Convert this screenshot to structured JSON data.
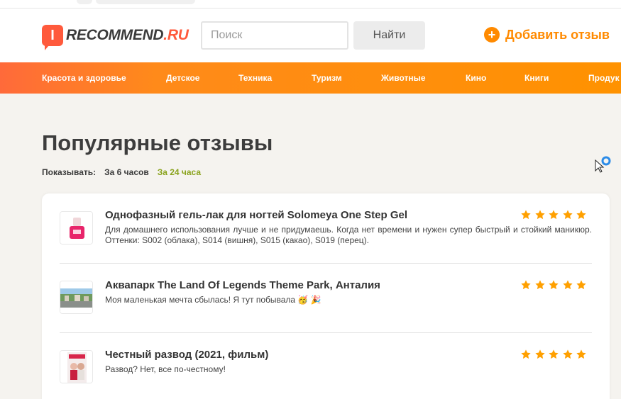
{
  "colors": {
    "brand_orange": "#ff8a00",
    "brand_red": "#ff5a3c",
    "active_filter": "#8aa31e",
    "star": "#ffa000"
  },
  "header": {
    "logo_mark": "I",
    "logo_main": "RECOMMEND",
    "logo_domain": ".RU",
    "search_placeholder": "Поиск",
    "search_button": "Найти",
    "add_review_icon": "plus-circle-icon",
    "add_review": "Добавить отзыв"
  },
  "nav": {
    "items": [
      {
        "label": "Красота и здоровье"
      },
      {
        "label": "Детское"
      },
      {
        "label": "Техника"
      },
      {
        "label": "Туризм"
      },
      {
        "label": "Животные"
      },
      {
        "label": "Кино"
      },
      {
        "label": "Книги"
      },
      {
        "label": "Продук"
      }
    ]
  },
  "main": {
    "title": "Популярные отзывы",
    "filter": {
      "label": "Показывать:",
      "options": [
        {
          "label": "За 6 часов",
          "active": false
        },
        {
          "label": "За 24 часа",
          "active": true
        }
      ]
    },
    "reviews": [
      {
        "title": "Однофазный гель-лак для ногтей Solomeya One Step Gel",
        "text": "Для домашнего использования лучше и не придумаешь. Когда нет времени и нужен супер быстрый и стойкий маникюр. Оттенки: S002 (облака), S014 (вишня), S015 (какао), S019 (перец).",
        "rating": 5,
        "thumb_icon": "nail-polish-thumbnail"
      },
      {
        "title": "Аквапарк The Land Of Legends Theme Park, Анталия",
        "text": "Моя маленькая мечта сбылась! Я тут побывала 🥳 🎉",
        "rating": 5,
        "thumb_icon": "aquapark-thumbnail"
      },
      {
        "title": "Честный развод (2021, фильм)",
        "text": "Развод? Нет, все по-честному!",
        "rating": 5,
        "thumb_icon": "movie-poster-thumbnail"
      }
    ]
  }
}
